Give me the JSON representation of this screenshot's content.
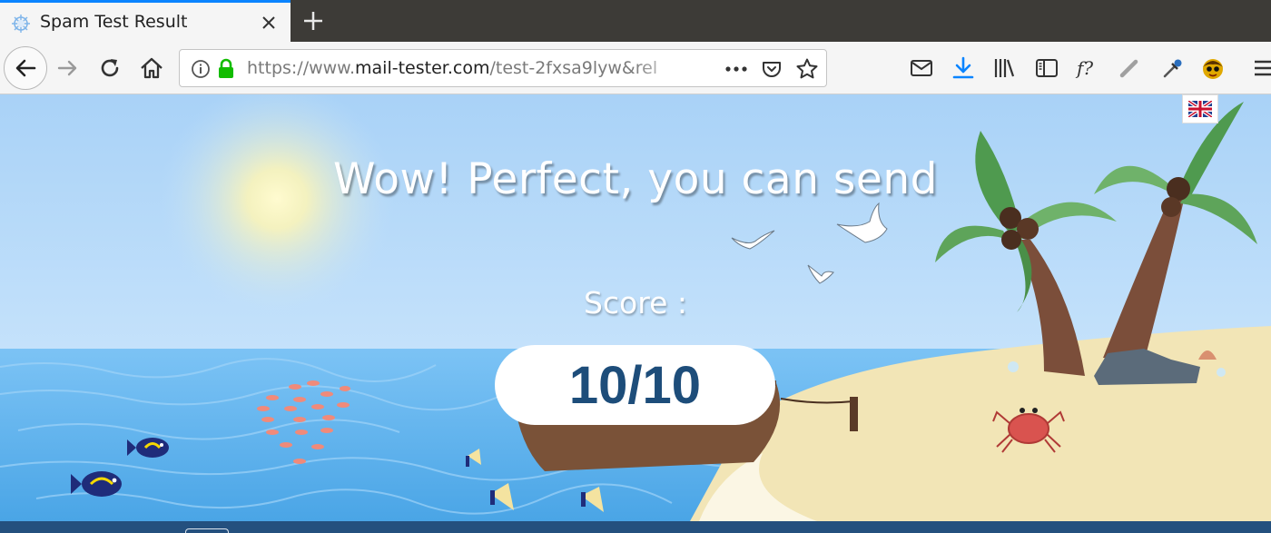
{
  "browser": {
    "tab": {
      "title": "Spam Test Result"
    },
    "url": {
      "prefix": "https://www.",
      "domain": "mail-tester.com",
      "path": "/test-2fxsa9lyw&rel"
    }
  },
  "page": {
    "headline": "Wow! Perfect, you can send",
    "score_label": "Score :",
    "score_value": "10/10"
  },
  "colors": {
    "accent": "#0a84ff",
    "score_text": "#1d4d7a",
    "sky": "#b3d6f5",
    "sea": "#6fbaf0",
    "sand": "#f2e5b6",
    "footer": "#24507e"
  },
  "icons": {
    "tab": [
      "favicon-icon",
      "close-icon",
      "plus-icon"
    ],
    "nav": [
      "back-arrow-icon",
      "forward-arrow-icon",
      "reload-icon",
      "home-icon",
      "info-icon",
      "lock-icon",
      "more-icon",
      "pocket-icon",
      "star-icon"
    ],
    "toolbar": [
      "mail-icon",
      "download-icon",
      "library-icon",
      "sidebar-icon",
      "font-finder-icon",
      "pencil-icon",
      "eyedropper-icon",
      "avatar-icon",
      "hamburger-menu-icon"
    ],
    "page": [
      "uk-flag-icon"
    ]
  }
}
